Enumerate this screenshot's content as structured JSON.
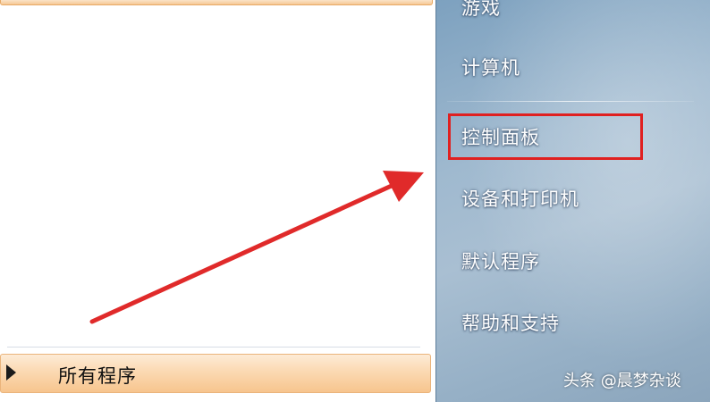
{
  "start_menu": {
    "left_pane": {
      "all_programs": {
        "label": "所有程序",
        "icon": "triangle-right-icon"
      }
    },
    "right_pane": {
      "items": [
        {
          "label": "游戏"
        },
        {
          "label": "计算机"
        },
        {
          "label": "控制面板",
          "highlighted": true
        },
        {
          "label": "设备和打印机"
        },
        {
          "label": "默认程序"
        },
        {
          "label": "帮助和支持"
        }
      ]
    }
  },
  "annotation": {
    "arrow_color": "#e02a2a",
    "highlight_color": "#e02020"
  },
  "watermark": {
    "text": "头条 @晨梦杂谈"
  },
  "colors": {
    "all_programs_bg": "#fbd9b2",
    "right_pane_bg": "#9fb9cf"
  }
}
